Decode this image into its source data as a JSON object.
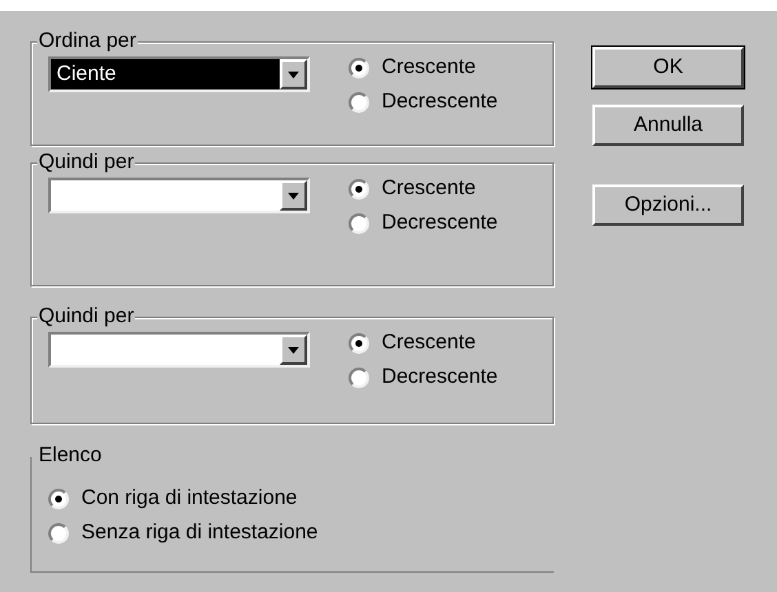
{
  "sort_groups": [
    {
      "title": "Ordina per",
      "value": "Ciente",
      "options": [
        {
          "label": "Crescente",
          "selected": true
        },
        {
          "label": "Decrescente",
          "selected": false
        }
      ]
    },
    {
      "title": "Quindi per",
      "options": [
        {
          "label": "Crescente",
          "selected": true
        },
        {
          "label": "Decrescente",
          "selected": false
        }
      ]
    },
    {
      "title": "Quindi per",
      "options": [
        {
          "label": "Crescente",
          "selected": true
        },
        {
          "label": "Decrescente",
          "selected": false
        }
      ]
    }
  ],
  "list_group": {
    "title": "Elenco",
    "options": [
      {
        "label": "Con riga di intestazione",
        "selected": true
      },
      {
        "label": "Senza riga di intestazione",
        "selected": false
      }
    ]
  },
  "buttons": [
    {
      "label": "OK",
      "default": true
    },
    {
      "label": "Annulla",
      "default": false
    },
    {
      "label": "Opzioni...",
      "default": false
    }
  ]
}
